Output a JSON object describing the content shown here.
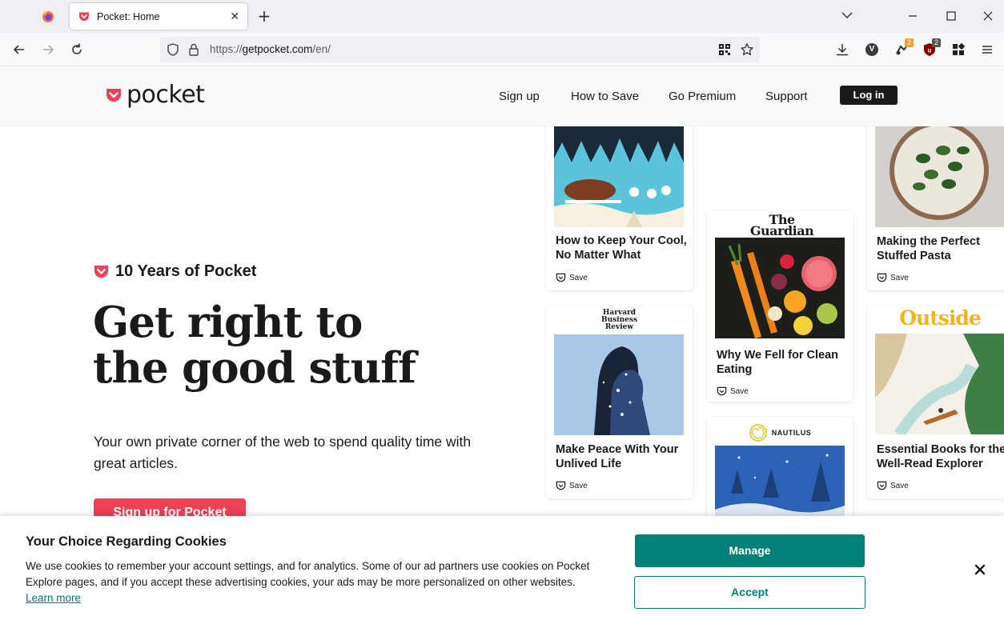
{
  "browser": {
    "active_tab_title": "Pocket: Home",
    "url_prefix": "https://",
    "url_host": "getpocket.com",
    "url_path": "/en/",
    "ext_badge_1": "2",
    "ext_badge_2": "2",
    "profile_initial": "V"
  },
  "colors": {
    "pocket_red": "#ef4056",
    "cookie_teal": "#008078"
  },
  "site": {
    "logo_text": "pocket",
    "nav": [
      "Sign up",
      "How to Save",
      "Go Premium",
      "Support"
    ],
    "login_label": "Log in"
  },
  "hero": {
    "kicker": "10 Years of Pocket",
    "headline_line1": "Get right to",
    "headline_line2": "the good stuff",
    "subtitle": "Your own private corner of the web to spend quality time with great articles.",
    "cta": "Sign up for Pocket"
  },
  "cards": [
    {
      "title": "How to Keep Your Cool, No Matter What",
      "save": "Save"
    },
    {
      "title": "Why We Fell for Clean Eating",
      "publisher": "The Guardian",
      "save": "Save"
    },
    {
      "title": "Making the Perfect Stuffed Pasta",
      "save": "Save"
    },
    {
      "title": "Make Peace With Your Unlived Life",
      "publisher": "Harvard Business Review",
      "save": "Save"
    },
    {
      "title": "Essential Books for the Well-Read Explorer",
      "publisher": "Outside",
      "save": "Save"
    },
    {
      "publisher": "NAUTILUS"
    }
  ],
  "cookie": {
    "title": "Your Choice Regarding Cookies",
    "body": "We use cookies to remember your account settings, and for analytics. Some of our ad partners use cookies on Pocket Explore pages, and if you accept these advertising cookies, your ads may be more personalized on other websites.",
    "learn_more": "Learn more",
    "manage": "Manage",
    "accept": "Accept"
  }
}
